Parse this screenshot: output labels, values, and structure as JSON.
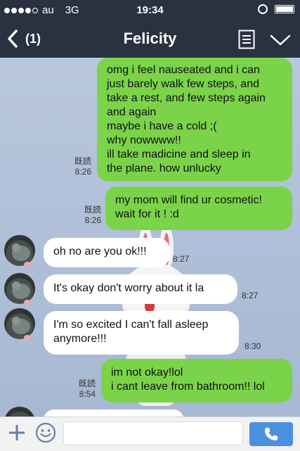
{
  "status_bar": {
    "carrier": "au",
    "network": "3G",
    "time": "19:34"
  },
  "header": {
    "back_count": "(1)",
    "title": "Felicity"
  },
  "messages": [
    {
      "side": "me",
      "read": "既読",
      "time": "8:26",
      "text": "omg i feel nauseated and i can\njust barely walk few steps, and\ntake a rest, and few steps again\nand again\nmaybe i have a cold ;(\nwhy nowwww!!\nill take madicine and sleep in\nthe plane. how unlucky"
    },
    {
      "side": "me",
      "read": "既読",
      "time": "8:26",
      "text": "my mom will find ur cosmetic!\nwait for it ! :d"
    },
    {
      "side": "them",
      "time": "8:27",
      "text": "oh no are you ok!!!"
    },
    {
      "side": "them",
      "time": "8:27",
      "text": "It's okay don't worry about it la"
    },
    {
      "side": "them",
      "time": "8:30",
      "text": "I'm so excited I can't fall asleep\nanymore!!!"
    },
    {
      "side": "me",
      "read": "既読",
      "time": "8:54",
      "text": "im not okay!lol\ni cant leave from bathroom!! lol"
    }
  ],
  "input": {
    "placeholder": ""
  },
  "colors": {
    "header_bg": "#2a3140",
    "my_bubble": "#7bd34a",
    "their_bubble": "#ffffff",
    "call_button": "#4b8fe0"
  },
  "icons": {
    "back": "chevron-left-icon",
    "menu": "note-list-icon",
    "expand": "chevron-down-icon",
    "add": "plus-icon",
    "emoji": "smiley-icon",
    "call": "phone-icon"
  }
}
